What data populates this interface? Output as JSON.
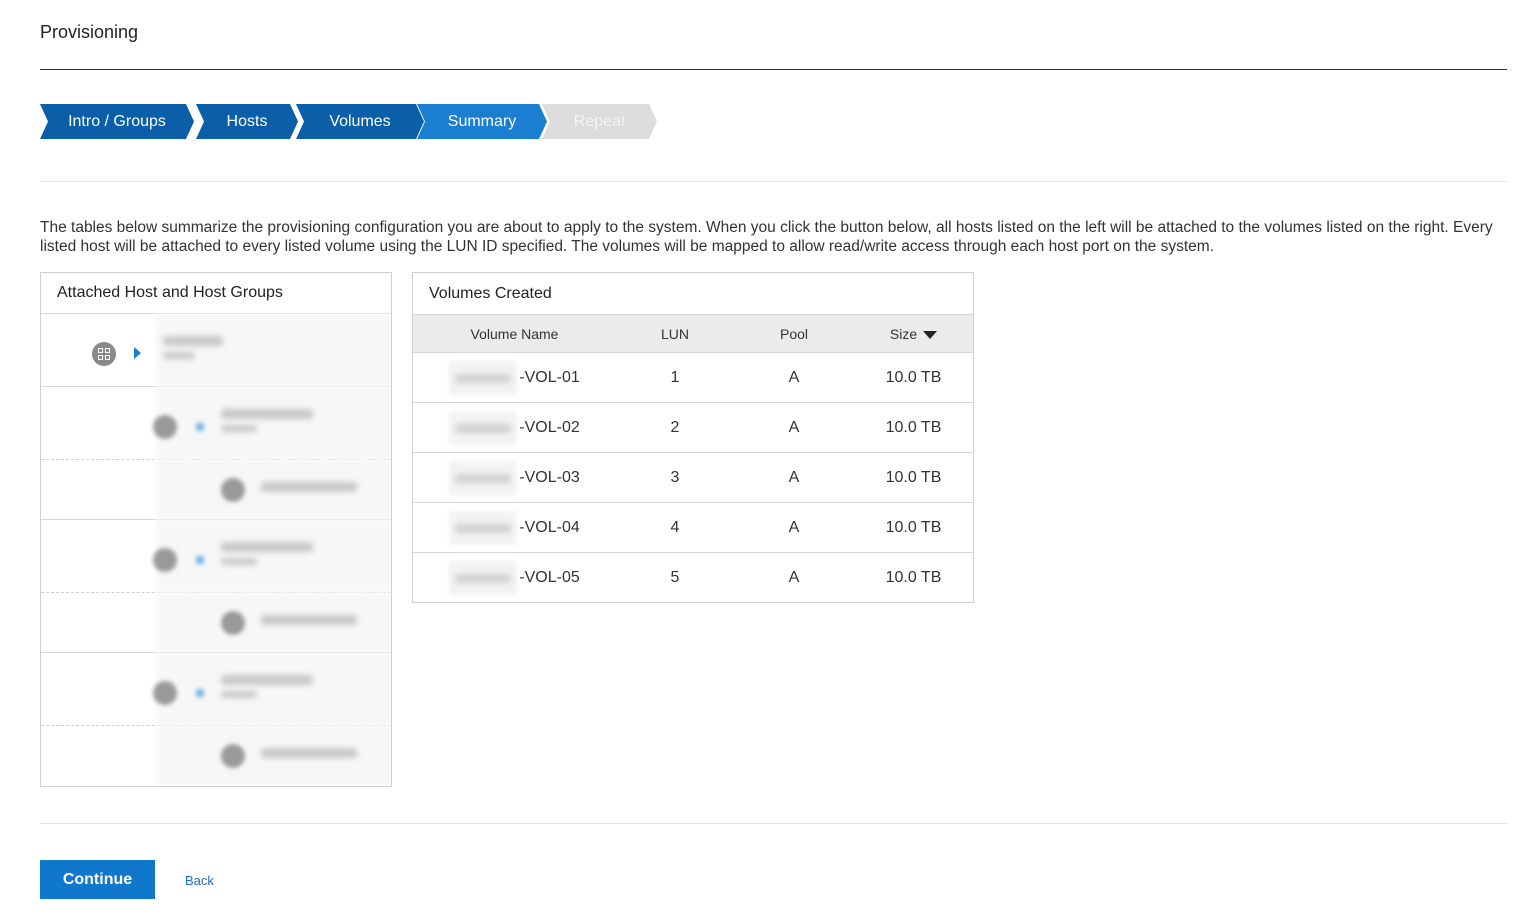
{
  "page": {
    "title": "Provisioning"
  },
  "stepper": {
    "steps": [
      {
        "label": "Intro / Groups",
        "state": "done"
      },
      {
        "label": "Hosts",
        "state": "done"
      },
      {
        "label": "Volumes",
        "state": "done"
      },
      {
        "label": "Summary",
        "state": "active"
      },
      {
        "label": "Repeat",
        "state": "todo"
      }
    ]
  },
  "description": "The tables below summarize the provisioning configuration you are about to apply to the system. When you click the button below, all hosts listed on the left will be attached to the volumes listed on the right. Every listed host will be attached to every listed volume using the LUN ID specified. The volumes will be mapped to allow read/write access through each host port on the system.",
  "hosts_panel": {
    "title": "Attached Host and Host Groups"
  },
  "volumes_panel": {
    "title": "Volumes Created",
    "columns": {
      "name": "Volume Name",
      "lun": "LUN",
      "pool": "Pool",
      "size": "Size"
    },
    "rows": [
      {
        "name_suffix": "-VOL-01",
        "lun": "1",
        "pool": "A",
        "size": "10.0 TB"
      },
      {
        "name_suffix": "-VOL-02",
        "lun": "2",
        "pool": "A",
        "size": "10.0 TB"
      },
      {
        "name_suffix": "-VOL-03",
        "lun": "3",
        "pool": "A",
        "size": "10.0 TB"
      },
      {
        "name_suffix": "-VOL-04",
        "lun": "4",
        "pool": "A",
        "size": "10.0 TB"
      },
      {
        "name_suffix": "-VOL-05",
        "lun": "5",
        "pool": "A",
        "size": "10.0 TB"
      }
    ]
  },
  "footer": {
    "continue_label": "Continue",
    "back_label": "Back"
  },
  "colors": {
    "step_done": "#0b5ea8",
    "step_active": "#1a7fd0",
    "step_todo": "#dcdcdc",
    "primary_button": "#0f77cc",
    "link": "#1a6fc0"
  },
  "icons": {
    "group": "host-group-icon",
    "expand": "caret-right-icon",
    "sort": "sort-down-icon"
  }
}
